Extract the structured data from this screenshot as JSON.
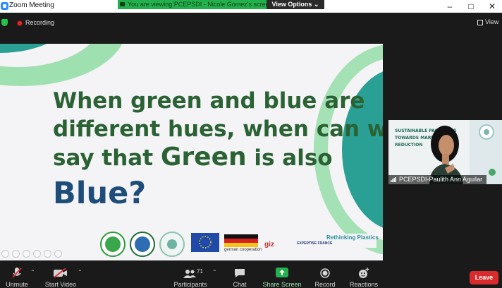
{
  "window": {
    "title": "Zoom Meeting",
    "controls": [
      "minimize-icon",
      "maximize-icon",
      "close-icon"
    ]
  },
  "share_banner": {
    "text": "You are viewing PCEPSDI - Nicole Gomez's screen",
    "view_options_label": "View Options",
    "color": "#23b14d"
  },
  "topbar": {
    "recording_label": "Recording",
    "view_label": "View"
  },
  "slide": {
    "line1": "When green and blue are",
    "line2": "different hues, when can we",
    "line3_pre": "say that ",
    "line3_big": "Green",
    "line3_post": " is also",
    "line4": "Blue?",
    "text_green": "#2b6234",
    "text_blue": "#1f4d7a",
    "logo_caption_germany": "german cooperation",
    "logo_caption_giz": "giz",
    "logo_caption_expertise": "EXPERTISE FRANCE",
    "logo_caption_rethinking": "Rethinking Plastics"
  },
  "participant_tile": {
    "name": "PCEPSDI-Paulith Ann Aguilar",
    "slide_text": [
      "SUSTAINABLE PACKAGING",
      "TOWARDS MARINE LITTER",
      "REDUCTION"
    ]
  },
  "toolbar": {
    "unmute_label": "Unmute",
    "start_video_label": "Start Video",
    "participants_label": "Participants",
    "participants_count": "71",
    "chat_label": "Chat",
    "share_screen_label": "Share Screen",
    "record_label": "Record",
    "reactions_label": "Reactions",
    "leave_label": "Leave",
    "share_color": "#23b14d",
    "leave_color": "#d92b2b"
  }
}
